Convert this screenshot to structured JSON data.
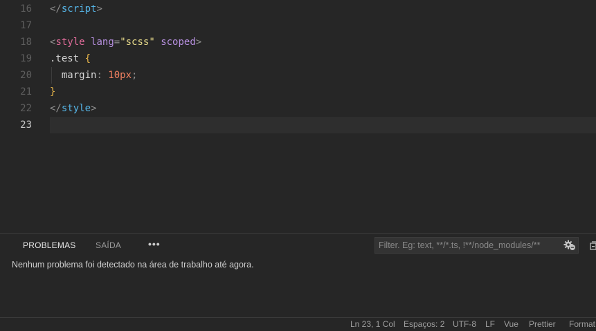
{
  "editor": {
    "lines": [
      {
        "number": "16",
        "parts": [
          [
            "tok-punct",
            "</"
          ],
          [
            "tok-tag-blue",
            "script"
          ],
          [
            "tok-punct",
            ">"
          ]
        ]
      },
      {
        "number": "17",
        "parts": []
      },
      {
        "number": "18",
        "parts": [
          [
            "tok-punct",
            "<"
          ],
          [
            "tok-tag",
            "style"
          ],
          [
            "tok-plain",
            " "
          ],
          [
            "tok-attr",
            "lang"
          ],
          [
            "tok-punct",
            "="
          ],
          [
            "tok-str",
            "\"scss\""
          ],
          [
            "tok-plain",
            " "
          ],
          [
            "tok-attr",
            "scoped"
          ],
          [
            "tok-punct",
            ">"
          ]
        ]
      },
      {
        "number": "19",
        "parts": [
          [
            "tok-selector",
            ".test"
          ],
          [
            "tok-plain",
            " "
          ],
          [
            "tok-brace",
            "{"
          ]
        ]
      },
      {
        "number": "20",
        "parts": [
          [
            "tok-plain",
            "  "
          ],
          [
            "tok-prop",
            "margin"
          ],
          [
            "tok-punct",
            ": "
          ],
          [
            "tok-num",
            "10px"
          ],
          [
            "tok-punct",
            ";"
          ]
        ],
        "indent_guide": true
      },
      {
        "number": "21",
        "parts": [
          [
            "tok-brace",
            "}"
          ]
        ]
      },
      {
        "number": "22",
        "parts": [
          [
            "tok-punct",
            "</"
          ],
          [
            "tok-tag-blue",
            "style"
          ],
          [
            "tok-punct",
            ">"
          ]
        ]
      },
      {
        "number": "23",
        "parts": [],
        "current": true
      }
    ]
  },
  "panel": {
    "tabs": {
      "problems": "PROBLEMAS",
      "output": "SAÍDA"
    },
    "more": "•••",
    "filter_placeholder": "Filter. Eg: text, **/*.ts, !**/node_modules/**",
    "message": "Nenhum problema foi detectado na área de trabalho até agora."
  },
  "status": {
    "position": "Ln 23, 1 Col",
    "spaces": "Espaços: 2",
    "encoding": "UTF-8",
    "eol": "LF",
    "language": "Vue",
    "prettier": "Prettier",
    "format": "Format"
  },
  "icons": {
    "filter": "filter-settings-icon",
    "collapse": "collapse-all-icon"
  }
}
